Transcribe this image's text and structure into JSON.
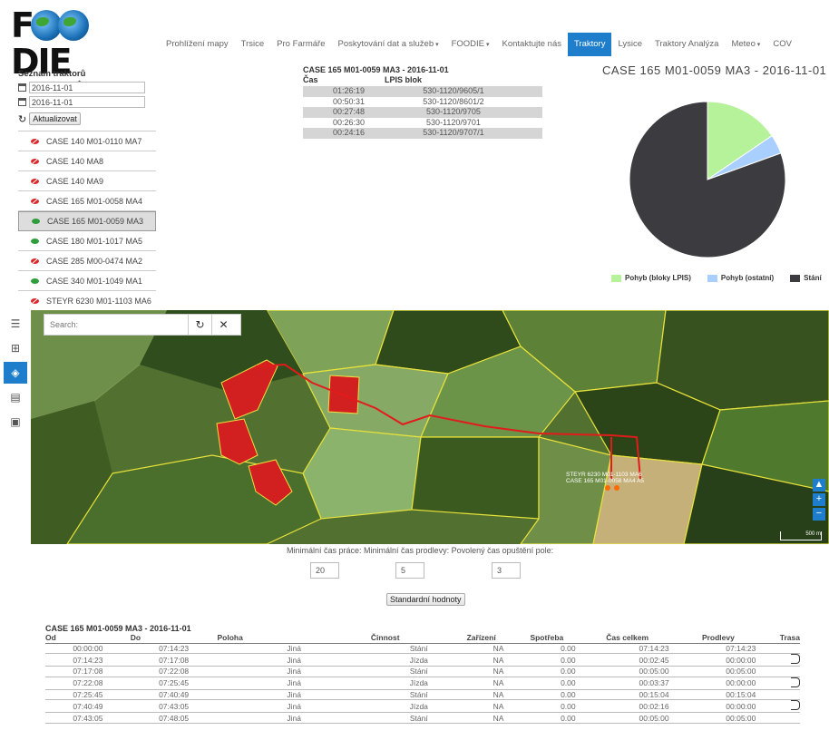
{
  "header": {
    "logo_text_left": "F",
    "logo_text_right": "DIE",
    "logo_tagline": "⚙ ☀ ☂ $ ▥ ✿ ▯",
    "nav": [
      {
        "label": "Prohlížení mapy",
        "caret": false
      },
      {
        "label": "Trsice",
        "caret": false
      },
      {
        "label": "Pro Farmáře",
        "caret": false
      },
      {
        "label": "Poskytování dat a služeb",
        "caret": true
      },
      {
        "label": "FOODIE",
        "caret": true
      },
      {
        "label": "Kontaktujte nás",
        "caret": false
      },
      {
        "label": "Traktory",
        "caret": false,
        "active": true
      },
      {
        "label": "Lysice",
        "caret": false
      },
      {
        "label": "Traktory Analýza",
        "caret": false
      },
      {
        "label": "Meteo",
        "caret": true
      },
      {
        "label": "COV",
        "caret": false
      }
    ]
  },
  "left_panel": {
    "title": "Seznam traktorů",
    "date_from": "2016-11-01",
    "date_to": "2016-11-01",
    "refresh_label": "Aktualizovat",
    "tractors": [
      {
        "name": "CASE 140 M01-0110 MA7",
        "visible": false
      },
      {
        "name": "CASE 140 MA8",
        "visible": false
      },
      {
        "name": "CASE 140 MA9",
        "visible": false
      },
      {
        "name": "CASE 165 M01-0058 MA4",
        "visible": false
      },
      {
        "name": "CASE 165 M01-0059 MA3",
        "visible": true,
        "selected": true
      },
      {
        "name": "CASE 180 M01-1017 MA5",
        "visible": true
      },
      {
        "name": "CASE 285 M00-0474 MA2",
        "visible": false
      },
      {
        "name": "CASE 340 M01-1049 MA1",
        "visible": true
      },
      {
        "name": "STEYR 6230 M01-1103 MA6",
        "visible": false
      }
    ]
  },
  "lpis": {
    "title": "CASE 165 M01-0059 MA3 - 2016-11-01",
    "col_time": "Čas",
    "col_block": "LPIS blok",
    "rows": [
      {
        "time": "01:26:19",
        "block": "530-1120/9605/1"
      },
      {
        "time": "00:50:31",
        "block": "530-1120/8601/2"
      },
      {
        "time": "00:27:48",
        "block": "530-1120/9705"
      },
      {
        "time": "00:26:30",
        "block": "530-1120/9701"
      },
      {
        "time": "00:24:16",
        "block": "530-1120/9707/1"
      }
    ]
  },
  "chart_data": {
    "type": "pie",
    "title": "CASE 165 M01-0059 MA3 - 2016-11-01",
    "series": [
      {
        "name": "Pohyb (bloky LPIS)",
        "value": 15.5,
        "color": "#b5f29a"
      },
      {
        "name": "Pohyb (ostatní)",
        "value": 4.0,
        "color": "#a8cfff"
      },
      {
        "name": "Stání",
        "value": 80.5,
        "color": "#3b3b40"
      }
    ],
    "legend_position": "bottom"
  },
  "map": {
    "search_placeholder": "Search:",
    "refresh_icon": "↻",
    "clear_icon": "✕",
    "vehicle_label_1": "STEYR 6230 M01-1103 MA6",
    "vehicle_label_2": "CASE 165 M01-0058 MA4 A5",
    "scale_label": "500 m",
    "toolbar": [
      "menu-icon",
      "grid-icon",
      "layers-icon",
      "document-icon",
      "save-icon"
    ]
  },
  "params": {
    "label": "Minimální čas práce: Minimální čas prodlevy: Povolený čas opuštění pole:",
    "min_work": "20",
    "min_pause": "5",
    "allowed_leave": "3",
    "default_button": "Standardní hodnoty"
  },
  "activity": {
    "title": "CASE 165 M01-0059 MA3 - 2016-11-01",
    "columns": [
      "Od",
      "Do",
      "Poloha",
      "Činnost",
      "Zařízení",
      "Spotřeba",
      "Čas celkem",
      "Prodlevy",
      "Trasa"
    ],
    "rows": [
      {
        "od": "00:00:00",
        "do": "07:14:23",
        "poloha": "Jiná",
        "cinnost": "Stání",
        "zarizeni": "NA",
        "spotreba": "0.00",
        "cas": "07:14:23",
        "prodlevy": "07:14:23",
        "trasa": false
      },
      {
        "od": "07:14:23",
        "do": "07:17:08",
        "poloha": "Jiná",
        "cinnost": "Jízda",
        "zarizeni": "NA",
        "spotreba": "0.00",
        "cas": "00:02:45",
        "prodlevy": "00:00:00",
        "trasa": true
      },
      {
        "od": "07:17:08",
        "do": "07:22:08",
        "poloha": "Jiná",
        "cinnost": "Stání",
        "zarizeni": "NA",
        "spotreba": "0.00",
        "cas": "00:05:00",
        "prodlevy": "00:05:00",
        "trasa": false
      },
      {
        "od": "07:22:08",
        "do": "07:25:45",
        "poloha": "Jiná",
        "cinnost": "Jízda",
        "zarizeni": "NA",
        "spotreba": "0.00",
        "cas": "00:03:37",
        "prodlevy": "00:00:00",
        "trasa": true
      },
      {
        "od": "07:25:45",
        "do": "07:40:49",
        "poloha": "Jiná",
        "cinnost": "Stání",
        "zarizeni": "NA",
        "spotreba": "0.00",
        "cas": "00:15:04",
        "prodlevy": "00:15:04",
        "trasa": false
      },
      {
        "od": "07:40:49",
        "do": "07:43:05",
        "poloha": "Jiná",
        "cinnost": "Jízda",
        "zarizeni": "NA",
        "spotreba": "0.00",
        "cas": "00:02:16",
        "prodlevy": "00:00:00",
        "trasa": true
      },
      {
        "od": "07:43:05",
        "do": "07:48:05",
        "poloha": "Jiná",
        "cinnost": "Stání",
        "zarizeni": "NA",
        "spotreba": "0.00",
        "cas": "00:05:00",
        "prodlevy": "00:05:00",
        "trasa": false
      }
    ]
  }
}
